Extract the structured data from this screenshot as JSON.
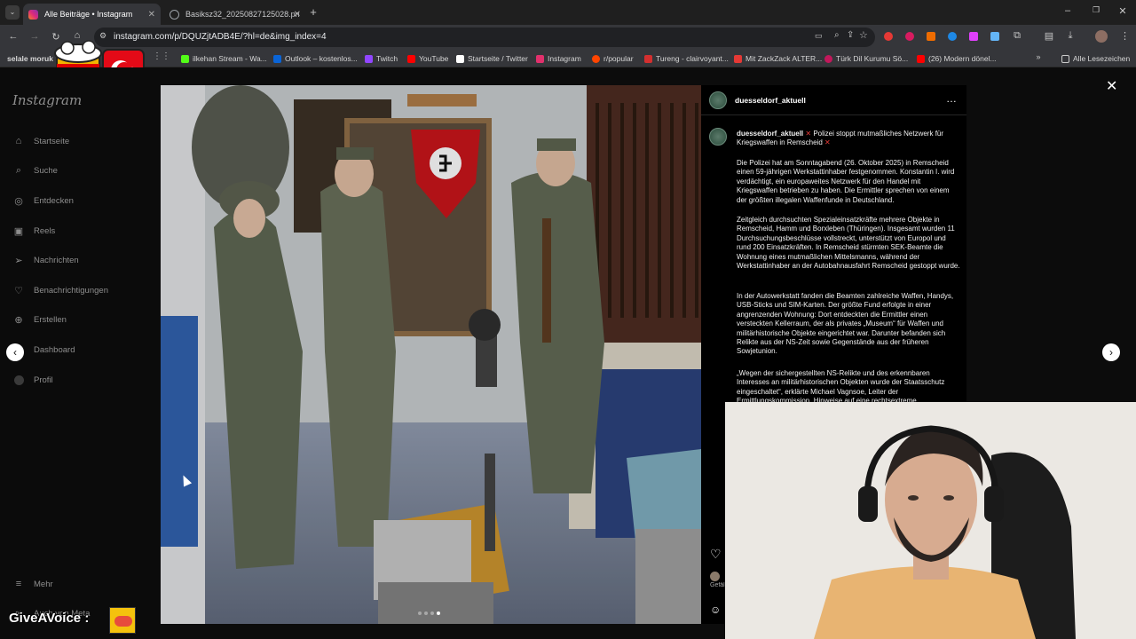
{
  "browser": {
    "tabs": [
      {
        "title": "Alle Beiträge • Instagram",
        "color": "#e1306c"
      },
      {
        "title": "Basiksz32_20250827125028.pn",
        "color": "#9aa0a6"
      }
    ],
    "url": "instagram.com/p/DQUZjtADB4E/?hl=de&img_index=4",
    "bookmarks": [
      {
        "label": "selale moruk",
        "color": "#f0a030"
      },
      {
        "label": "ilkehan Stream - Wa...",
        "color": "#53fc18"
      },
      {
        "label": "Outlook – kostenlos...",
        "color": "#0a64d6"
      },
      {
        "label": "Twitch",
        "color": "#9146ff"
      },
      {
        "label": "YouTube",
        "color": "#ff0000"
      },
      {
        "label": "Startseite / Twitter",
        "color": "#ffffff"
      },
      {
        "label": "Instagram",
        "color": "#e1306c"
      },
      {
        "label": "r/popular",
        "color": "#ff4500"
      },
      {
        "label": "Tureng - clairvoyant...",
        "color": "#d32f2f"
      },
      {
        "label": "Mit ZackZack ALTER...",
        "color": "#e53935"
      },
      {
        "label": "Türk Dil Kurumu Sö...",
        "color": "#c2185b"
      },
      {
        "label": "(26) Modern dönel...",
        "color": "#ff0000"
      }
    ],
    "all_bookmarks": "Alle Lesezeichen"
  },
  "instagram": {
    "logo": "Instagram",
    "nav": [
      {
        "label": "Startseite",
        "icon": "home-icon"
      },
      {
        "label": "Suche",
        "icon": "search-icon"
      },
      {
        "label": "Entdecken",
        "icon": "compass-icon"
      },
      {
        "label": "Reels",
        "icon": "reels-icon"
      },
      {
        "label": "Nachrichten",
        "icon": "send-icon"
      },
      {
        "label": "Benachrichtigungen",
        "icon": "heart-icon"
      },
      {
        "label": "Erstellen",
        "icon": "plus-icon"
      },
      {
        "label": "Dashboard",
        "icon": "dashboard-icon"
      },
      {
        "label": "Profil",
        "icon": "profile-icon"
      }
    ],
    "more": "Mehr",
    "also_from_meta": "Auch von Meta",
    "post": {
      "username": "duesseldorf_aktuell",
      "caption_title": "Polizei stoppt mutmaßliches Netzwerk für Kriegswaffen in Remscheid",
      "paragraphs": [
        "Die Polizei hat am Sonntagabend (26. Oktober 2025) in Remscheid einen 59-jährigen Werkstattinhaber festgenommen. Konstantin I. wird verdächtigt, ein europaweites Netzwerk für den Handel mit Kriegswaffen betrieben zu haben. Die Ermittler sprechen von einem der größten illegalen Waffenfunde in Deutschland.",
        "Zeitgleich durchsuchten Spezialeinsatzkräfte mehrere Objekte in Remscheid, Hamm und Borxleben (Thüringen). Insgesamt wurden 11 Durchsuchungsbeschlüsse vollstreckt, unterstützt von Europol und rund 200 Einsatzkräften. In Remscheid stürmten SEK-Beamte die Wohnung eines mutmaßlichen Mittelsmanns, während der Werkstattinhaber an der Autobahnausfahrt Remscheid gestoppt wurde.",
        "In der Autowerkstatt fanden die Beamten zahlreiche Waffen, Handys, USB-Sticks und SIM-Karten. Der größte Fund erfolgte in einer angrenzenden Wohnung: Dort entdeckten die Ermittler einen versteckten Kellerraum, der als privates „Museum“ für Waffen und militärhistorische Objekte eingerichtet war. Darunter befanden sich Relikte aus der NS-Zeit sowie Gegenstände aus der früheren Sowjetunion.",
        "„Wegen der sichergestellten NS-Relikte und des erkennbaren Interesses an militärhistorischen Objekten wurde der Staatsschutz eingeschaltet“, erklärte Michael Vagnsoe, Leiter der Ermittlungskommission. Hinweise auf eine rechtsextreme"
      ],
      "likes_prefix": "Gefällt"
    }
  },
  "overlay": {
    "give_a_voice": "GiveAVoice :"
  }
}
